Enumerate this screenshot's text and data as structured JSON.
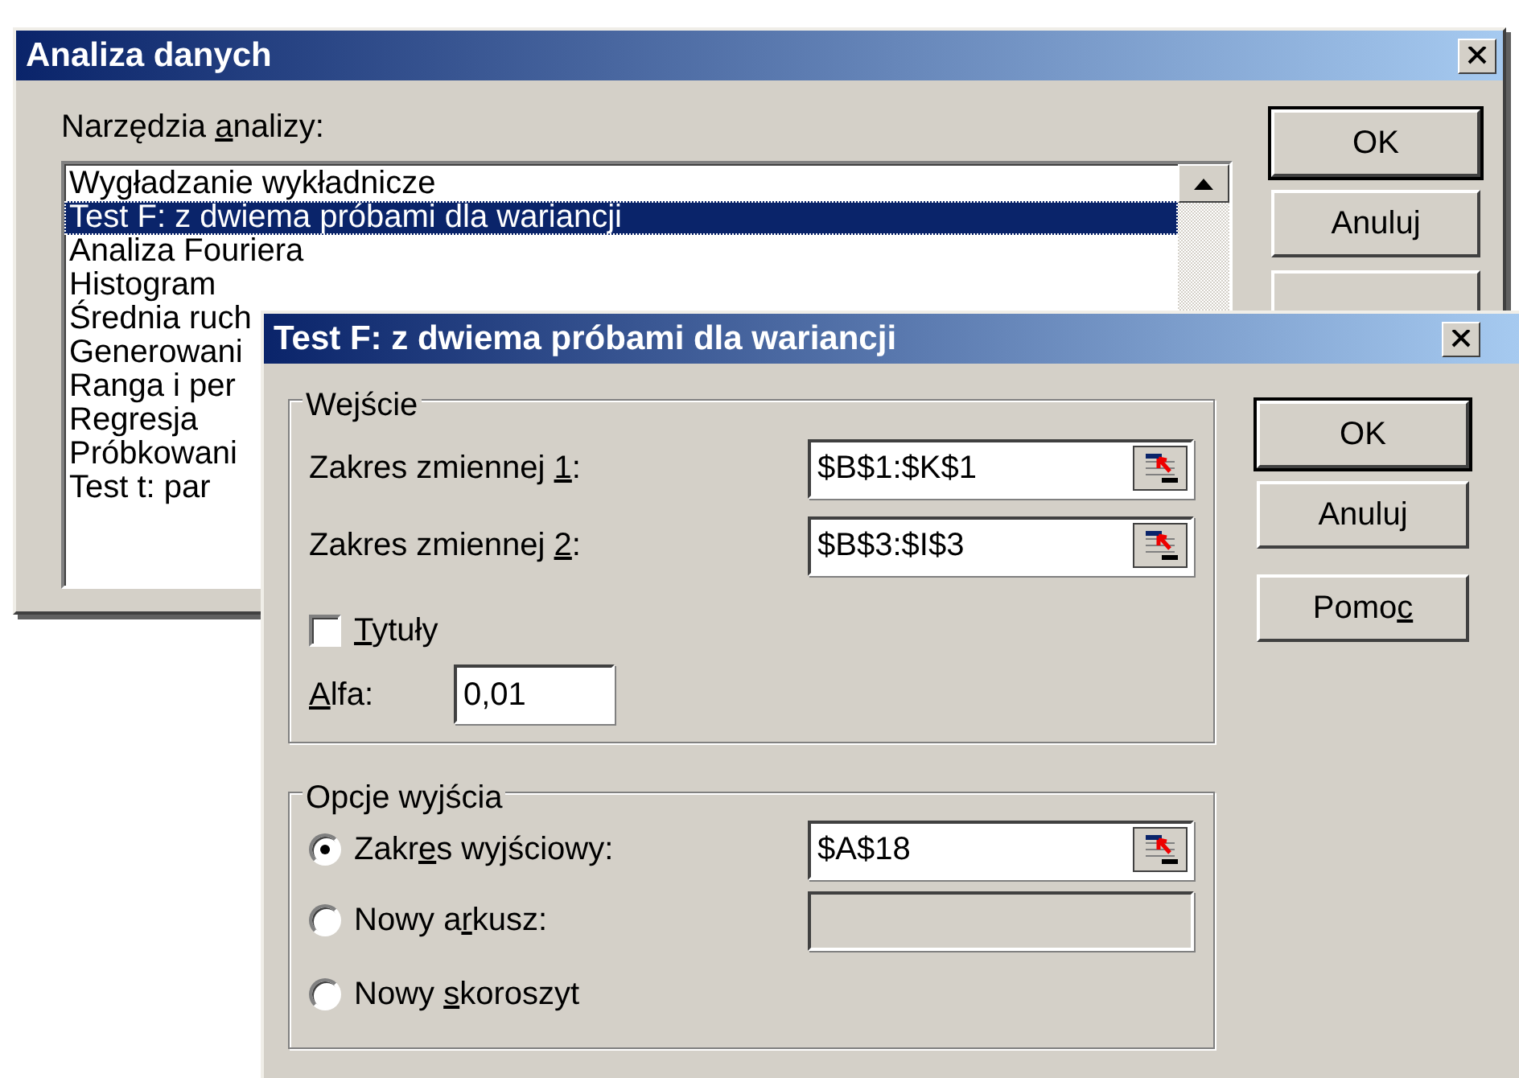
{
  "analysis_window": {
    "title": "Analiza danych",
    "list_label": {
      "before": "Narzędzia ",
      "key": "a",
      "after": "nalizy:"
    },
    "tools": [
      {
        "label": "Wygładzanie wykładnicze",
        "selected": false
      },
      {
        "label": "Test F: z dwiema próbami dla wariancji",
        "selected": true
      },
      {
        "label": "Analiza Fouriera",
        "selected": false
      },
      {
        "label": "Histogram",
        "selected": false
      },
      {
        "label": "Średnia ruch",
        "selected": false
      },
      {
        "label": "Generowani",
        "selected": false
      },
      {
        "label": "Ranga i per",
        "selected": false
      },
      {
        "label": "Regresja",
        "selected": false
      },
      {
        "label": "Próbkowani",
        "selected": false
      },
      {
        "label": "Test t: par",
        "selected": false
      }
    ],
    "buttons": [
      {
        "label": "OK",
        "default": true
      },
      {
        "label": "Anuluj",
        "default": false
      }
    ]
  },
  "test_dialog": {
    "title": "Test F: z dwiema próbami dla wariancji",
    "input_group": {
      "legend": "Wejście",
      "ranges": [
        {
          "label": {
            "before": "Zakres zmiennej ",
            "key": "1",
            "after": ":"
          },
          "value": "$B$1:$K$1"
        },
        {
          "label": {
            "before": "Zakres zmiennej ",
            "key": "2",
            "after": ":"
          },
          "value": "$B$3:$I$3"
        }
      ],
      "labels_checkbox": {
        "label": {
          "key": "T",
          "after": "ytuły"
        },
        "checked": false
      },
      "alpha": {
        "label": {
          "key": "A",
          "after": "lfa:"
        },
        "value": "0,01"
      }
    },
    "output_group": {
      "legend": "Opcje wyjścia",
      "options": [
        {
          "label": {
            "before": "Zakr",
            "key": "e",
            "after": "s wyjściowy:"
          },
          "selected": true,
          "field": {
            "value": "$A$18",
            "disabled": false
          }
        },
        {
          "label": {
            "before": "Nowy a",
            "key": "r",
            "after": "kusz:"
          },
          "selected": false,
          "field": {
            "disabled": true
          }
        },
        {
          "label": {
            "before": "Nowy ",
            "key": "s",
            "after": "koroszyt"
          },
          "selected": false
        }
      ]
    },
    "buttons": [
      {
        "label": {
          "before": "OK"
        },
        "default": true
      },
      {
        "label": {
          "before": "Anuluj"
        },
        "default": false
      },
      {
        "label": {
          "before": "Pomo",
          "key": "c"
        },
        "default": false
      }
    ]
  }
}
